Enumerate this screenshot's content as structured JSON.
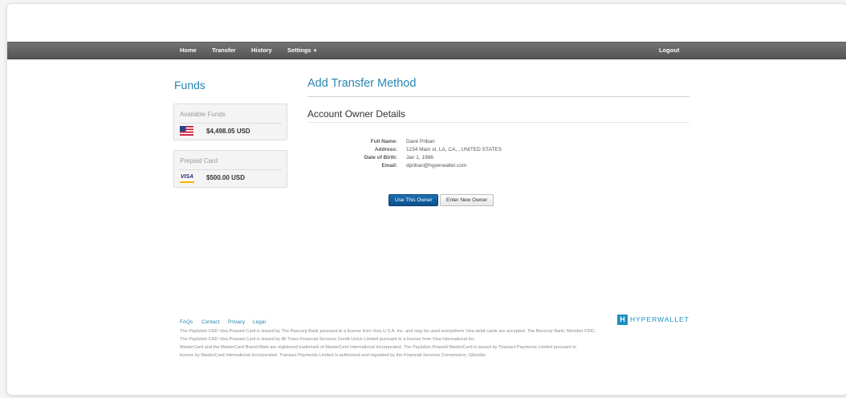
{
  "nav": {
    "home": "Home",
    "transfer": "Transfer",
    "history": "History",
    "settings": "Settings",
    "logout": "Logout"
  },
  "sidebar": {
    "title": "Funds",
    "available": {
      "label": "Available Funds",
      "amount": "$4,498.05 USD",
      "icon": "us-flag-icon"
    },
    "prepaid": {
      "label": "Prepaid Card",
      "amount": "$500.00 USD",
      "icon": "visa-icon",
      "brand": "VISA"
    }
  },
  "main": {
    "title": "Add Transfer Method",
    "section": "Account Owner Details",
    "details": [
      {
        "label": "Full Name:",
        "value": "Dave Priban"
      },
      {
        "label": "Address:",
        "value": "1234 Main st, LA, CA, , UNITED STATES"
      },
      {
        "label": "Date of Birth:",
        "value": "Jan 1, 1986"
      },
      {
        "label": "Email:",
        "value": "dpriban@hyperwallet.com"
      }
    ],
    "use_owner_label": "Use This Owner",
    "new_owner_label": "Enter New Owner"
  },
  "footer": {
    "links": [
      "FAQs",
      "Contact",
      "Privacy",
      "Legal"
    ],
    "logo_mark": "H",
    "logo_text": "HYPERWALLET",
    "lines": [
      "The Paylution USD Visa Prepaid Card is issued by The Bancorp Bank pursuant to a license from Visa U.S.A. Inc. and may be used everywhere Visa debit cards are accepted. The Bancorp Bank; Member FDIC.",
      "The Paylution CAD Visa Prepaid Card is issued by All Trans Financial Services Credit Union Limited pursuant to a license from Visa International Inc.",
      "MasterCard and the MasterCard Brand Mark are registered trademark of MasterCard International Incorporated. The Paylution Prepaid MasterCard is issued by Transact Payments Limited pursuant to",
      "licence by MasterCard International Incorporated. Transact Payments Limited is authorised and regulated by the Financial Services Commission, Gibraltar"
    ]
  },
  "colors": {
    "accent": "#2a86b3",
    "primary_button": "#0b4f8c",
    "navbar": "#5f5f5f"
  }
}
